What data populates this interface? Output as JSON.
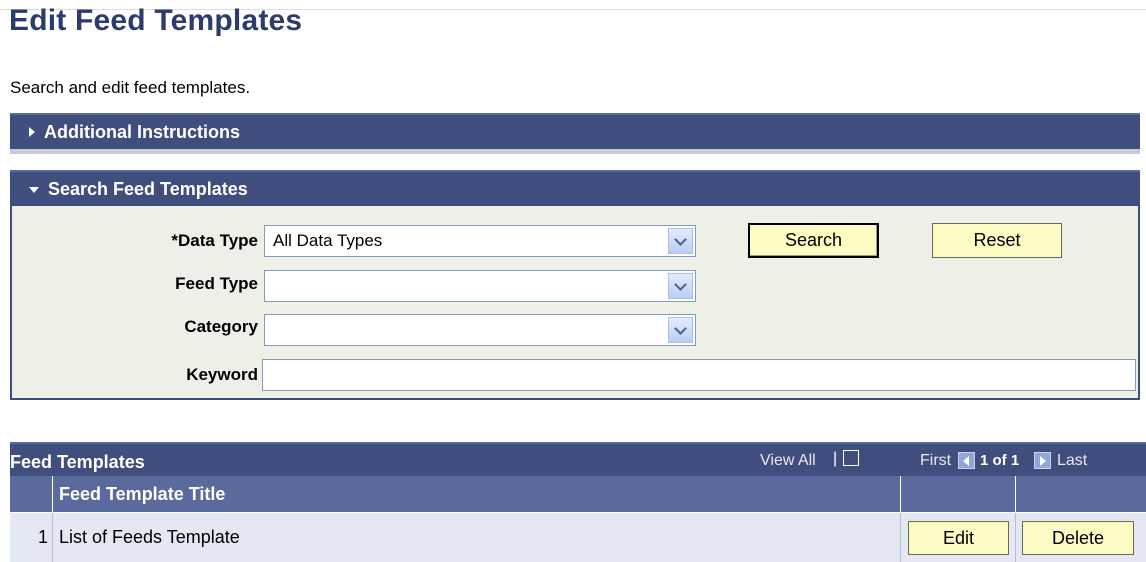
{
  "page": {
    "title": "Edit Feed Templates",
    "description": "Search and edit feed templates."
  },
  "sections": {
    "additional_instructions": "Additional Instructions",
    "search_feed_templates": "Search Feed Templates"
  },
  "search_form": {
    "data_type": {
      "label": "*Data Type",
      "value": "All Data Types"
    },
    "feed_type": {
      "label": "Feed Type",
      "value": ""
    },
    "category": {
      "label": "Category",
      "value": ""
    },
    "keyword": {
      "label": "Keyword",
      "value": ""
    },
    "search_button": "Search",
    "reset_button": "Reset"
  },
  "grid": {
    "title": "Feed Templates",
    "view_all": "View All",
    "first": "First",
    "counter": "1 of 1",
    "last": "Last",
    "column_title": "Feed Template Title",
    "rows": [
      {
        "num": "1",
        "title": "List of Feeds Template",
        "edit": "Edit",
        "delete": "Delete"
      }
    ]
  },
  "colors": {
    "header_bar": "#3f4e7c",
    "title": "#2b3b6b",
    "button": "#fdfbc4",
    "panel": "#eef0e8",
    "row": "#e3e8f3"
  },
  "icons": [
    "expand-arrow-icon",
    "collapse-arrow-icon",
    "chevron-down-icon",
    "zoom-grid-icon",
    "first-page-icon",
    "last-page-icon"
  ]
}
